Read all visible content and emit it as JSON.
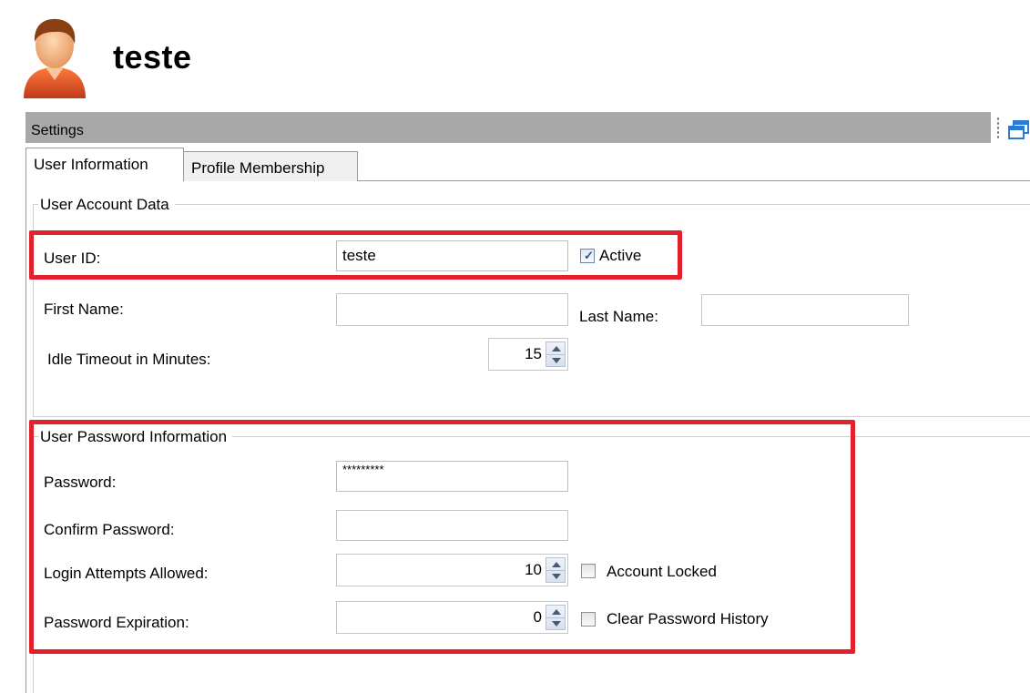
{
  "header": {
    "title": "teste",
    "avatar_icon": "user-avatar-icon"
  },
  "settings_bar": {
    "title": "Settings",
    "window_icon": "restore-window-icon"
  },
  "tabs": [
    {
      "label": "User Information",
      "active": true
    },
    {
      "label": "Profile Membership",
      "active": false
    }
  ],
  "account_group": {
    "legend": "User Account Data",
    "user_id": {
      "label": "User ID:",
      "value": "teste"
    },
    "active": {
      "label": "Active",
      "checked": true
    },
    "first_name": {
      "label": "First Name:",
      "value": ""
    },
    "last_name": {
      "label": "Last Name:",
      "value": ""
    },
    "idle_timeout": {
      "label": "Idle Timeout in Minutes:",
      "value": "15"
    }
  },
  "password_group": {
    "legend": "User Password Information",
    "password": {
      "label": "Password:",
      "value": "*********"
    },
    "confirm_password": {
      "label": "Confirm Password:",
      "value": ""
    },
    "login_attempts": {
      "label": "Login Attempts Allowed:",
      "value": "10"
    },
    "account_locked": {
      "label": "Account Locked",
      "checked": false
    },
    "password_expiration": {
      "label": "Password Expiration:",
      "value": "0"
    },
    "clear_history": {
      "label": "Clear Password History",
      "checked": false
    }
  },
  "colors": {
    "highlight": "#e3202b",
    "settings_bar": "#a8a8a8"
  }
}
